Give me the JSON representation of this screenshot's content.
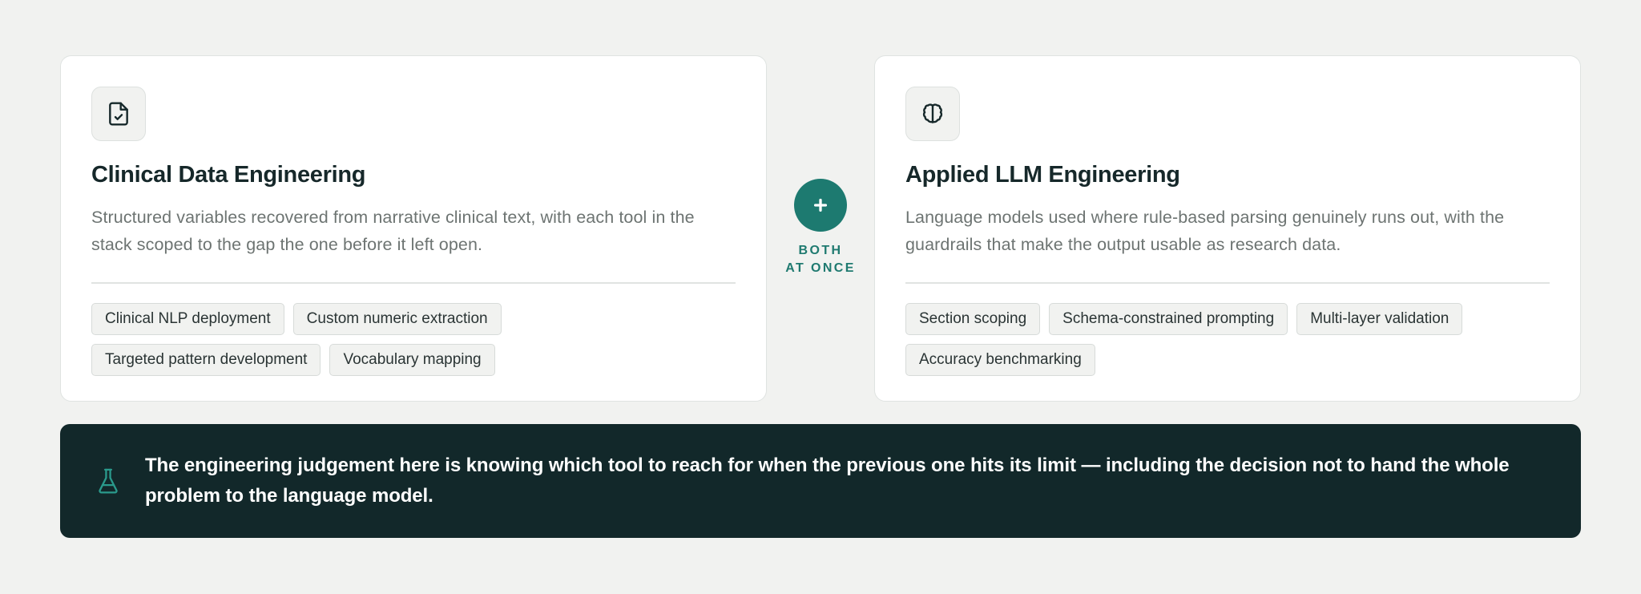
{
  "cards": [
    {
      "icon": "file-check-icon",
      "title": "Clinical Data Engineering",
      "description": "Structured variables recovered from narrative clinical text, with each tool in the stack scoped to the gap the one before it left open.",
      "tags": [
        "Clinical NLP deployment",
        "Custom numeric extraction",
        "Targeted pattern development",
        "Vocabulary mapping"
      ]
    },
    {
      "icon": "brain-icon",
      "title": "Applied LLM Engineering",
      "description": "Language models used where rule-based parsing genuinely runs out, with the guardrails that make the output usable as research data.",
      "tags": [
        "Section scoping",
        "Schema-constrained prompting",
        "Multi-layer validation",
        "Accuracy benchmarking"
      ]
    }
  ],
  "connector": {
    "icon": "plus-icon",
    "line1": "BOTH",
    "line2": "AT ONCE"
  },
  "banner": {
    "icon": "flask-icon",
    "text": "The engineering judgement here is knowing which tool to reach for when the previous one hits its limit — including the decision not to hand the whole problem to the language model."
  },
  "colors": {
    "background": "#f1f2f0",
    "accent": "#1d7a70",
    "banner": "#12282a",
    "title": "#16282a",
    "muted": "#6d7472"
  }
}
